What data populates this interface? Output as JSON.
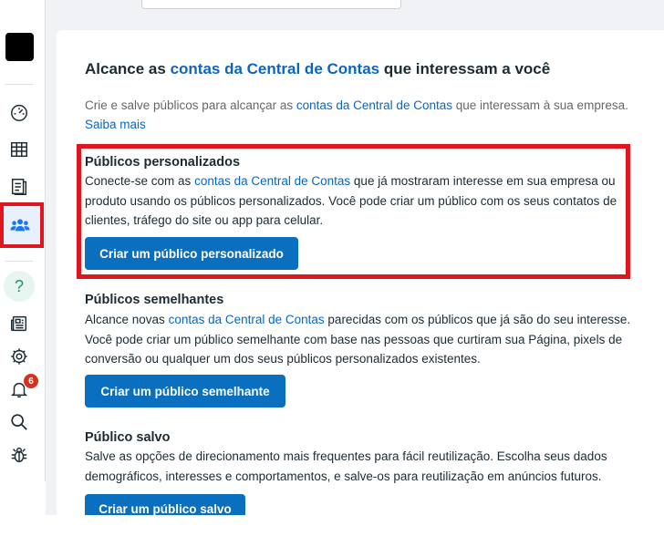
{
  "sidebar": {
    "notification_count": "6",
    "help_label": "?",
    "icons": [
      "dashboard-icon",
      "table-icon",
      "catalog-icon",
      "audience-icon",
      "help-icon",
      "news-icon",
      "gear-icon",
      "bell-icon",
      "search-icon",
      "bug-icon"
    ]
  },
  "main": {
    "title": {
      "pre": "Alcance as ",
      "link": "contas da Central de Contas",
      "post": " que interessam a você"
    },
    "subtitle": {
      "pre": "Crie e salve públicos para alcançar as ",
      "link": "contas da Central de Contas",
      "post": " que interessam à sua empresa. ",
      "learn_more": "Saiba mais"
    },
    "sections": [
      {
        "title": "Públicos personalizados",
        "desc_pre": "Conecte-se com as ",
        "desc_link": "contas da Central de Contas",
        "desc_post": " que já mostraram interesse em sua empresa ou produto usando os públicos personalizados. Você pode criar um público com os seus contatos de clientes, tráfego do site ou app para celular.",
        "button": "Criar um público personalizado"
      },
      {
        "title": "Públicos semelhantes",
        "desc_pre": "Alcance novas ",
        "desc_link": "contas da Central de Contas",
        "desc_post": " parecidas com os públicos que já são do seu interesse. Você pode criar um público semelhante com base nas pessoas que curtiram sua Página, pixels de conversão ou qualquer um dos seus públicos personalizados existentes.",
        "button": "Criar um público semelhante"
      },
      {
        "title": "Público salvo",
        "desc_pre": "Salve as opções de direcionamento mais frequentes para fácil reutilização. Escolha seus dados demográficos, interesses e comportamentos, e salve-os para reutilização em anúncios futuros.",
        "desc_link": "",
        "desc_post": "",
        "button": "Criar um público salvo"
      }
    ]
  },
  "colors": {
    "accent": "#0b6fbf",
    "link": "#0a66c2",
    "highlight": "#e0161e",
    "badge": "#d6311f"
  }
}
